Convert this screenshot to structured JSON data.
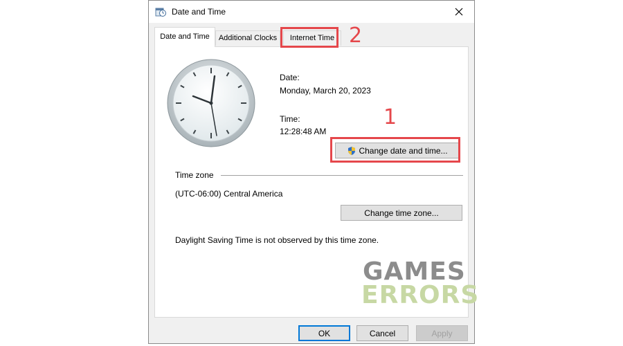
{
  "window": {
    "title": "Date and Time",
    "close_icon": "close-icon"
  },
  "tabs": [
    {
      "label": "Date and Time",
      "active": true
    },
    {
      "label": "Additional Clocks",
      "active": false
    },
    {
      "label": "Internet Time",
      "active": false
    }
  ],
  "date_section": {
    "date_label": "Date:",
    "date_value": "Monday, March 20, 2023",
    "time_label": "Time:",
    "time_value": "12:28:48 AM"
  },
  "change_datetime_button": {
    "label": "Change date and time...",
    "icon": "shield-icon"
  },
  "timezone_section": {
    "heading": "Time zone",
    "value": "(UTC-06:00) Central America",
    "change_button": "Change time zone..."
  },
  "dst_note": "Daylight Saving Time is not observed by this time zone.",
  "footer": {
    "ok": "OK",
    "cancel": "Cancel",
    "apply": "Apply"
  },
  "annotations": {
    "step1": "1",
    "step2": "2",
    "color": "#e5474b"
  },
  "watermark": {
    "line1": "GAMES",
    "line2": "ERRORS",
    "color1": "#8c8c8c",
    "color2": "#c7d8a4"
  }
}
